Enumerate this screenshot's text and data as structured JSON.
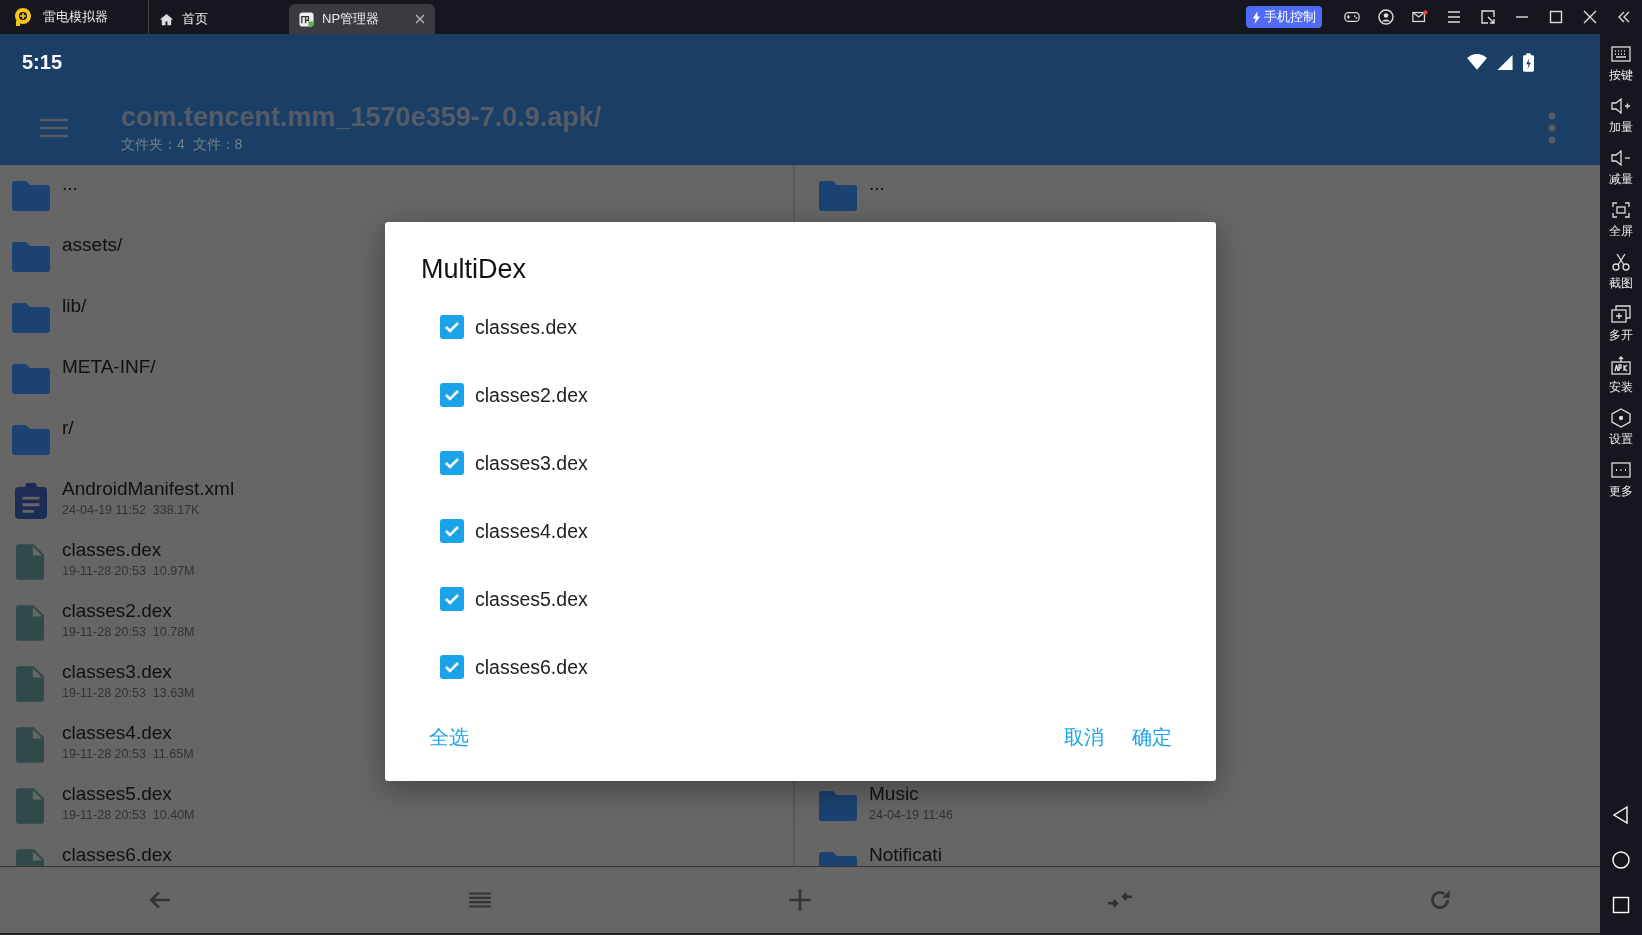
{
  "emulator_bar": {
    "app_name": "雷电模拟器",
    "tabs": [
      {
        "label": "首页",
        "kind": "home",
        "selected": false
      },
      {
        "label": "NP管理器",
        "kind": "app",
        "selected": true
      }
    ],
    "control_badge": "手机控制",
    "mail_unread": true
  },
  "status_bar": {
    "time": "5:15"
  },
  "header": {
    "title": "com.tencent.mm_1570e359-7.0.9.apk/",
    "subtitle": "文件夹：4  文件：8"
  },
  "left_pane": {
    "items": [
      {
        "name": "...",
        "kind": "folder"
      },
      {
        "name": "assets/",
        "kind": "folder"
      },
      {
        "name": "lib/",
        "kind": "folder"
      },
      {
        "name": "META-INF/",
        "kind": "folder"
      },
      {
        "name": "r/",
        "kind": "folder"
      },
      {
        "name": "AndroidManifest.xml",
        "meta": "24-04-19 11:52  338.17K",
        "kind": "manifest"
      },
      {
        "name": "classes.dex",
        "meta": "19-11-28 20:53  10.97M",
        "kind": "file"
      },
      {
        "name": "classes2.dex",
        "meta": "19-11-28 20:53  10.78M",
        "kind": "file"
      },
      {
        "name": "classes3.dex",
        "meta": "19-11-28 20:53  13.63M",
        "kind": "file"
      },
      {
        "name": "classes4.dex",
        "meta": "19-11-28 20:53  11.65M",
        "kind": "file"
      },
      {
        "name": "classes5.dex",
        "meta": "19-11-28 20:53  10.40M",
        "kind": "file"
      },
      {
        "name": "classes6.dex",
        "kind": "file"
      }
    ]
  },
  "right_pane": {
    "items": [
      {
        "name": "...",
        "kind": "folder"
      },
      {
        "name": "Music",
        "meta": "24-04-19 11:46",
        "kind": "folder"
      },
      {
        "name": "Notificati",
        "kind": "folder"
      }
    ]
  },
  "dialog": {
    "title": "MultiDex",
    "options": [
      {
        "label": "classes.dex",
        "checked": true
      },
      {
        "label": "classes2.dex",
        "checked": true
      },
      {
        "label": "classes3.dex",
        "checked": true
      },
      {
        "label": "classes4.dex",
        "checked": true
      },
      {
        "label": "classes5.dex",
        "checked": true
      },
      {
        "label": "classes6.dex",
        "checked": true
      }
    ],
    "select_all": "全选",
    "cancel": "取消",
    "confirm": "确定"
  },
  "side_panel": {
    "items": [
      {
        "label": "按键",
        "kind": "keyboard"
      },
      {
        "label": "加量",
        "kind": "volume-up"
      },
      {
        "label": "减量",
        "kind": "volume-down"
      },
      {
        "label": "全屏",
        "kind": "fullscreen"
      },
      {
        "label": "截图",
        "kind": "scissors"
      },
      {
        "label": "多开",
        "kind": "multi"
      },
      {
        "label": "安装",
        "kind": "apk"
      },
      {
        "label": "设置",
        "kind": "settings"
      },
      {
        "label": "更多",
        "kind": "more"
      }
    ]
  }
}
